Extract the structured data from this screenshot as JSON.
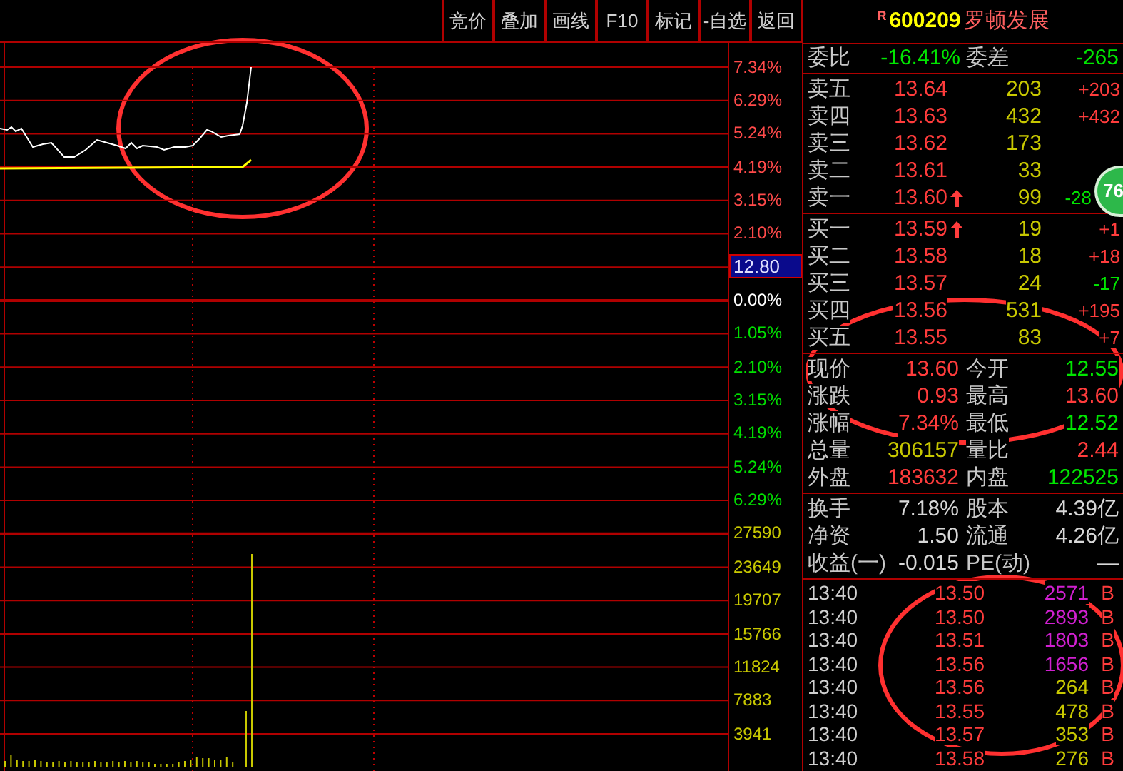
{
  "toolbar": {
    "buttons": [
      "竞价",
      "叠加",
      "画线",
      "F10",
      "标记",
      "-自选",
      "返回"
    ]
  },
  "stock": {
    "badge": "R",
    "code": "600209",
    "name": "罗顿发展"
  },
  "axis_labels": [
    {
      "text": "7.34%",
      "kind": "up"
    },
    {
      "text": "6.29%",
      "kind": "up"
    },
    {
      "text": "5.24%",
      "kind": "up"
    },
    {
      "text": "4.19%",
      "kind": "up"
    },
    {
      "text": "3.15%",
      "kind": "up"
    },
    {
      "text": "2.10%",
      "kind": "up"
    },
    {
      "text": "12.80",
      "kind": "cursor"
    },
    {
      "text": "0.00%",
      "kind": "flat"
    },
    {
      "text": "1.05%",
      "kind": "down"
    },
    {
      "text": "2.10%",
      "kind": "down"
    },
    {
      "text": "3.15%",
      "kind": "down"
    },
    {
      "text": "4.19%",
      "kind": "down"
    },
    {
      "text": "5.24%",
      "kind": "down"
    },
    {
      "text": "6.29%",
      "kind": "down"
    },
    {
      "text": "27590",
      "kind": "volume"
    },
    {
      "text": "23649",
      "kind": "volume"
    },
    {
      "text": "19707",
      "kind": "volume"
    },
    {
      "text": "15766",
      "kind": "volume"
    },
    {
      "text": "11824",
      "kind": "volume"
    },
    {
      "text": "7883",
      "kind": "volume"
    },
    {
      "text": "3941",
      "kind": "volume"
    }
  ],
  "commission": {
    "label": "委比",
    "value": "-16.41%",
    "label2": "委差",
    "value2": "-265"
  },
  "asks": [
    {
      "label": "卖五",
      "price": "13.64",
      "uptick": false,
      "volume": "203",
      "change": "+203",
      "color": "#ff3c3c"
    },
    {
      "label": "卖四",
      "price": "13.63",
      "uptick": false,
      "volume": "432",
      "change": "+432",
      "color": "#ff3c3c"
    },
    {
      "label": "卖三",
      "price": "13.62",
      "uptick": false,
      "volume": "173"
    },
    {
      "label": "卖二",
      "price": "13.61",
      "uptick": false,
      "volume": "33"
    },
    {
      "label": "卖一",
      "price": "13.60",
      "uptick": true,
      "volume": "99",
      "change": "-28",
      "color": "#00e600"
    }
  ],
  "bids": [
    {
      "label": "买一",
      "price": "13.59",
      "uptick": true,
      "volume": "19",
      "change": "+1",
      "color": "#ff3c3c"
    },
    {
      "label": "买二",
      "price": "13.58",
      "uptick": false,
      "volume": "18",
      "change": "+18",
      "color": "#ff3c3c"
    },
    {
      "label": "买三",
      "price": "13.57",
      "uptick": false,
      "volume": "24",
      "change": "-17",
      "color": "#00e600"
    },
    {
      "label": "买四",
      "price": "13.56",
      "uptick": false,
      "volume": "531",
      "change": "+195",
      "color": "#ff3c3c"
    },
    {
      "label": "买五",
      "price": "13.55",
      "uptick": false,
      "volume": "83",
      "change": "+7",
      "color": "#ff3c3c"
    }
  ],
  "quote": [
    {
      "label": "现价",
      "value": "13.60",
      "color": "#ff3c3c"
    },
    {
      "label": "今开",
      "value": "12.55",
      "color": "#00e600"
    },
    {
      "label": "涨跌",
      "value": "0.93",
      "color": "#ff3c3c"
    },
    {
      "label": "最高",
      "value": "13.60",
      "color": "#ff3c3c"
    },
    {
      "label": "涨幅",
      "value": "7.34%",
      "color": "#ff3c3c"
    },
    {
      "label": "最低",
      "value": "12.52",
      "color": "#00e600"
    },
    {
      "label": "总量",
      "value": "306157",
      "color": "#c8c800"
    },
    {
      "label": "量比",
      "value": "2.44",
      "color": "#ff3c3c"
    },
    {
      "label": "外盘",
      "value": "183632",
      "color": "#ff3c3c"
    },
    {
      "label": "内盘",
      "value": "122525",
      "color": "#00e600"
    }
  ],
  "fundamentals": [
    {
      "label": "换手",
      "value": "7.18%"
    },
    {
      "label": "股本",
      "value": "4.39亿"
    },
    {
      "label": "净资",
      "value": "1.50"
    },
    {
      "label": "流通",
      "value": "4.26亿"
    },
    {
      "label": "收益(一)",
      "value": "-0.015"
    },
    {
      "label": "PE(动)",
      "value": "—"
    }
  ],
  "trades": [
    {
      "time": "13:40",
      "price": "13.50",
      "volume": "2571",
      "color": "#d020d0",
      "side": "B"
    },
    {
      "time": "13:40",
      "price": "13.50",
      "volume": "2893",
      "color": "#d020d0",
      "side": "B"
    },
    {
      "time": "13:40",
      "price": "13.51",
      "volume": "1803",
      "color": "#d020d0",
      "side": "B"
    },
    {
      "time": "13:40",
      "price": "13.56",
      "volume": "1656",
      "color": "#d020d0",
      "side": "B"
    },
    {
      "time": "13:40",
      "price": "13.56",
      "volume": "264",
      "color": "#c8c800",
      "side": "B"
    },
    {
      "time": "13:40",
      "price": "13.55",
      "volume": "478",
      "color": "#c8c800",
      "side": "B"
    },
    {
      "time": "13:40",
      "price": "13.57",
      "volume": "353",
      "color": "#c8c800",
      "side": "B"
    },
    {
      "time": "13:40",
      "price": "13.58",
      "volume": "276",
      "color": "#c8c800",
      "side": "B"
    }
  ],
  "floating_badge": "76"
}
